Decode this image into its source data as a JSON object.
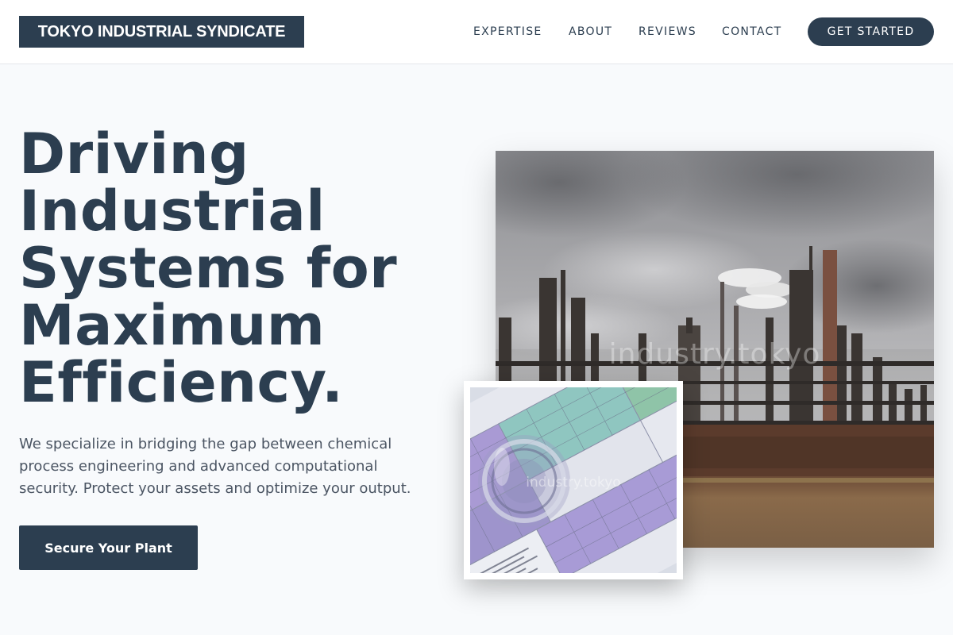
{
  "header": {
    "logo": "TOKYO INDUSTRIAL SYNDICATE",
    "nav": [
      "EXPERTISE",
      "ABOUT",
      "REVIEWS",
      "CONTACT"
    ],
    "cta": "GET STARTED"
  },
  "hero": {
    "title_lines": [
      "Driving",
      "Industrial",
      "Systems for",
      "Maximum",
      "Efficiency."
    ],
    "description": "We specialize in bridging the gap between chemical process engineering and advanced computational security. Protect your assets and optimize your output.",
    "button": "Secure Your Plant"
  },
  "images": {
    "main_watermark": "industry.tokyo",
    "inset_watermark": "industry.tokyo"
  },
  "colors": {
    "primary": "#2c3e50",
    "background": "#f8fafc"
  }
}
